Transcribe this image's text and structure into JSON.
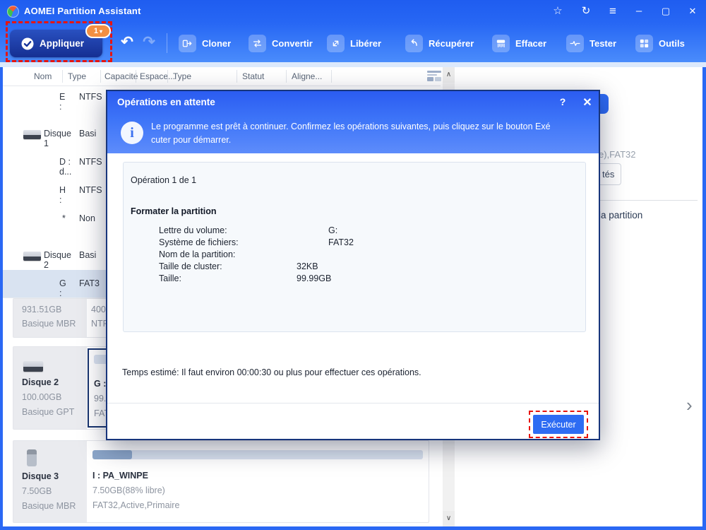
{
  "window": {
    "title": "AOMEI Partition Assistant"
  },
  "titlebar": {
    "star": "☆",
    "sync": "↻",
    "menu": "≡",
    "minimize": "–",
    "maximize": "▢",
    "close": "✕"
  },
  "toolbar": {
    "apply": {
      "label": "Appliquer",
      "badge": "1",
      "badge_caret": "▾",
      "check_icon": "✓"
    },
    "undo_icon": "↶",
    "redo_icon": "↷",
    "items": [
      {
        "label": "Cloner"
      },
      {
        "label": "Convertir"
      },
      {
        "label": "Libérer"
      },
      {
        "label": "Récupérer"
      },
      {
        "label": "Effacer"
      },
      {
        "label": "Tester"
      },
      {
        "label": "Outils"
      }
    ]
  },
  "table": {
    "headers": [
      "Nom",
      "Type",
      "Capacité",
      "Espace...",
      "Type",
      "Statut",
      "Aligne..."
    ],
    "rows": [
      {
        "name": "E :",
        "type": "NTFS"
      },
      {
        "name": "Disque 1",
        "type": "Basi"
      },
      {
        "name": "D : d...",
        "type": "NTFS"
      },
      {
        "name": "H :",
        "type": "NTFS"
      },
      {
        "name": "*",
        "type": "Non"
      },
      {
        "name": "Disque 2",
        "type": "Basi"
      },
      {
        "name": "G :",
        "type": "FAT3"
      }
    ]
  },
  "disk_map": {
    "card1": {
      "size": "931.51GB",
      "style": "Basique MBR",
      "part_line1": "400",
      "part_line2": "NTF"
    },
    "card2": {
      "name": "Disque 2",
      "size": "100.00GB",
      "style": "Basique GPT",
      "part": {
        "name": "G :",
        "size": "99.9",
        "fs": "FAT"
      }
    },
    "card3": {
      "name": "Disque 3",
      "size": "7.50GB",
      "style": "Basique MBR",
      "part": {
        "name": "I : PA_WINPE",
        "size": "7.50GB(88% libre)",
        "fs": "FAT32,Active,Primaire",
        "used_percent": 12
      }
    }
  },
  "scrollbar": {
    "up": "∧",
    "down": "∨"
  },
  "right_panel": {
    "fs_fragment": "e),FAT32",
    "button_fragment": "tés",
    "link_fragment": "la partition",
    "chevron": "›"
  },
  "dialog": {
    "title": "Opérations en attente",
    "help": "?",
    "close": "✕",
    "info_icon": "i",
    "message_line1": "Le programme est prêt à continuer. Confirmez les opérations suivantes, puis cliquez sur le bouton Exé",
    "message_line2": "cuter pour démarrer.",
    "operation": {
      "counter": "Opération 1 de 1",
      "title": "Formater la partition",
      "fields": [
        {
          "label": "Lettre du volume:",
          "value": "G:"
        },
        {
          "label": "Système de fichiers:",
          "value": "FAT32"
        },
        {
          "label": "Nom de la partition:",
          "value": ""
        },
        {
          "label": "Taille de cluster:",
          "value": "32KB"
        },
        {
          "label": "Taille:",
          "value": "99.99GB"
        }
      ]
    },
    "time_note": "Temps estimé: Il faut environ 00:00:30 ou plus pour effectuer ces opérations.",
    "execute_label": "Exécuter"
  },
  "colors": {
    "accent_blue": "#2a68f4",
    "apply_navy": "#152f92",
    "badge_orange": "#f28f42",
    "highlight_red": "#e8140c",
    "row_selection": "#d9e3f1",
    "bar_fill": "#8ba6c9",
    "bar_track": "#d9e2ef"
  }
}
